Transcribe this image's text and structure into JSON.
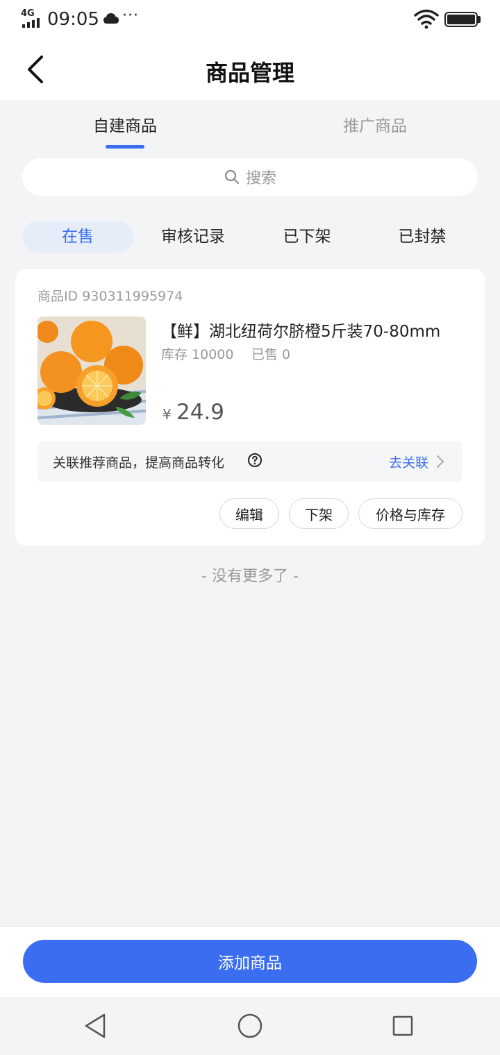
{
  "status_bar": {
    "network": "4G",
    "time": "09:05",
    "dots": "···"
  },
  "header": {
    "title": "商品管理"
  },
  "top_tabs": [
    {
      "label": "自建商品",
      "active": true
    },
    {
      "label": "推广商品",
      "active": false
    }
  ],
  "search": {
    "placeholder": "搜索"
  },
  "filters": [
    {
      "label": "在售",
      "active": true
    },
    {
      "label": "审核记录",
      "active": false
    },
    {
      "label": "已下架",
      "active": false
    },
    {
      "label": "已封禁",
      "active": false
    }
  ],
  "product": {
    "id_text": "商品ID 930311995974",
    "name": "【鲜】湖北纽荷尔脐橙5斤装70-80mm",
    "stock": "库存 10000",
    "sold": "已售 0",
    "currency": "¥",
    "price": "24.9",
    "assoc_text": "关联推荐商品，提高商品转化",
    "assoc_link": "去关联",
    "actions": {
      "edit": "编辑",
      "off_shelf": "下架",
      "price_stock": "价格与库存"
    }
  },
  "list_end": "- 没有更多了 -",
  "bottom": {
    "add_button": "添加商品"
  },
  "colors": {
    "accent": "#3a6df0",
    "background": "#f3f4f6",
    "muted_text": "#9a9a9a"
  }
}
